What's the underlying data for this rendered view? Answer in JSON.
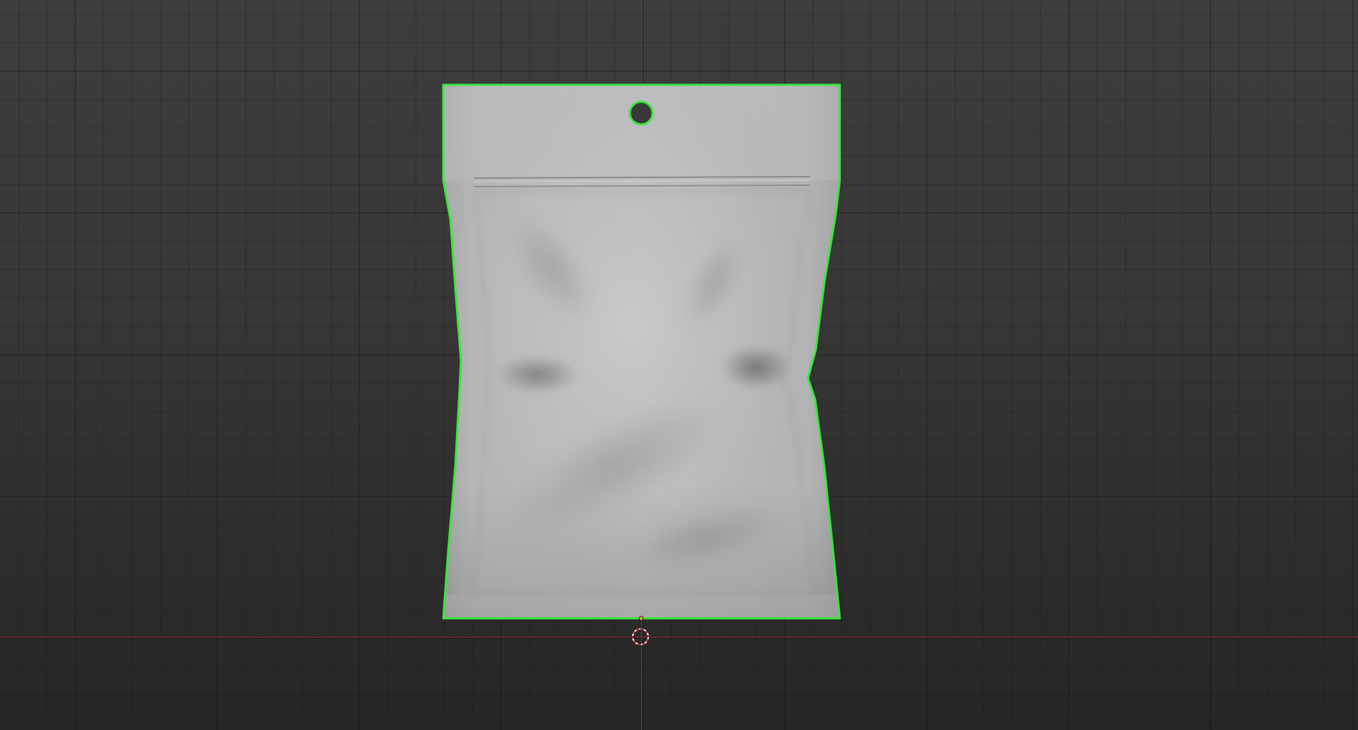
{
  "app": {
    "view": "3d-viewport"
  },
  "colors": {
    "background": "#383838",
    "grid_line": "#2a2a2a",
    "x_axis": "#8a2a2a",
    "z_axis": "#3b3fa6",
    "selection_outline": "#36e83a",
    "mesh_base": "#b9babb"
  },
  "objects": [
    {
      "name": "pouch",
      "type": "mesh",
      "selected": true,
      "features": [
        "hang-hole",
        "zip-seal"
      ]
    }
  ],
  "icons": {
    "cursor": "3d-cursor-icon",
    "origin": "object-origin-icon"
  }
}
